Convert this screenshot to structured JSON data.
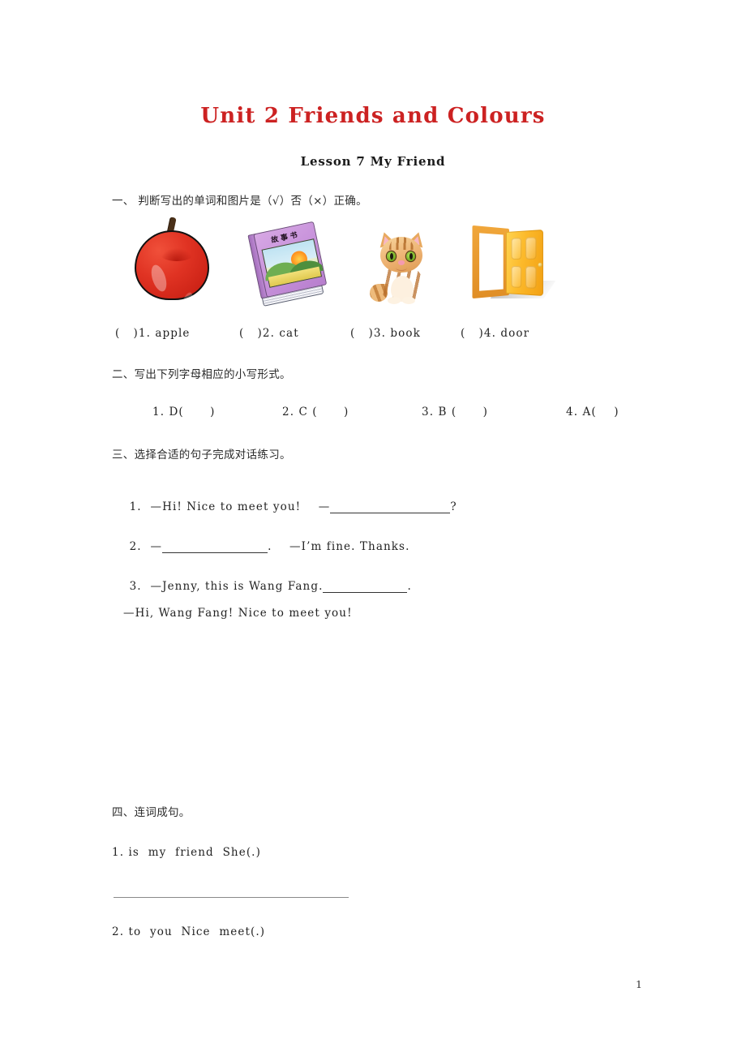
{
  "document": {
    "title": "Unit 2 Friends and Colours",
    "lesson": "Lesson 7 My Friend",
    "page_number": "1",
    "title_color": "#cc2222"
  },
  "sections": [
    {
      "id": "section-1",
      "heading": "一、 判断写出的单词和图片是（√）否（×）正确。",
      "pictures": [
        {
          "icon": "apple-icon",
          "label": "（  ）1. apple"
        },
        {
          "icon": "storybook-icon",
          "label": "（  ）2. cat",
          "cover_text": "故事书"
        },
        {
          "icon": "cat-icon",
          "label": "（  ）3. book"
        },
        {
          "icon": "door-icon",
          "label": "（  ）4. door"
        }
      ],
      "labels": [
        "(   )1. apple",
        "(   )2. cat",
        "(   )3. book",
        "(   )4. door"
      ]
    },
    {
      "id": "section-2",
      "heading": "二、写出下列字母相应的小写形式。",
      "items": [
        "1. D(      )",
        "2. C (      )",
        "3. B (      )",
        "4. A(    )"
      ]
    },
    {
      "id": "section-3",
      "heading": "三、选择合适的句子完成对话练习。",
      "items": [
        {
          "number": "1.",
          "before": "—Hi! Nice to meet you!    —",
          "after": "?"
        },
        {
          "number": "2.",
          "before": "—",
          "after": ".    —I’m fine. Thanks."
        },
        {
          "number": "3.",
          "before": "—Jenny, this is Wang Fang.",
          "after": "."
        }
      ],
      "continuation": "—Hi, Wang Fang! Nice to meet you!"
    },
    {
      "id": "section-4",
      "heading": "四、连词成句。",
      "items": [
        "1. is  my  friend  She(.)",
        "2. to  you  Nice  meet(.)"
      ]
    }
  ]
}
